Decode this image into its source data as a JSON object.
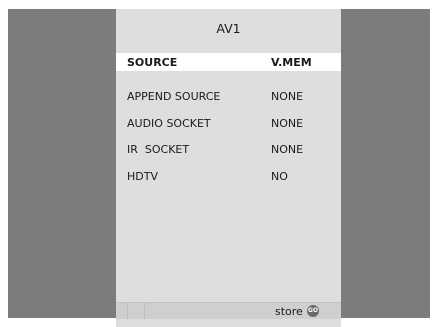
{
  "menu": {
    "title": "AV1",
    "rows": [
      {
        "label": "SOURCE",
        "value": "V.MEM"
      },
      {
        "label": "APPEND SOURCE",
        "value": "NONE"
      },
      {
        "label": "AUDIO SOCKET",
        "value": "NONE"
      },
      {
        "label": "IR  SOCKET",
        "value": "NONE"
      },
      {
        "label": "HDTV",
        "value": "NO"
      }
    ]
  },
  "statusbar": {
    "store_label": "store",
    "go_label": "GO",
    "go_icon": "go-button-icon"
  },
  "colors": {
    "background": "#7c7c7c",
    "menu_panel": "#dedede",
    "highlight": "#ffffff"
  }
}
